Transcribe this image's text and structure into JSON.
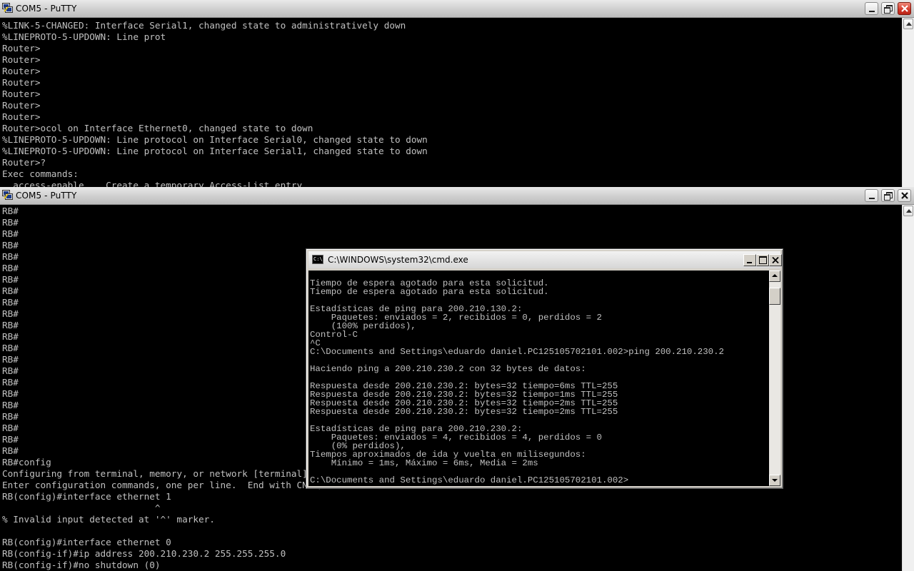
{
  "putty_top": {
    "title": "COM5 - PuTTY",
    "terminal_text": "%LINK-5-CHANGED: Interface Serial1, changed state to administratively down\n%LINEPROTO-5-UPDOWN: Line prot\nRouter>\nRouter>\nRouter>\nRouter>\nRouter>\nRouter>\nRouter>\nRouter>ocol on Interface Ethernet0, changed state to down\n%LINEPROTO-5-UPDOWN: Line protocol on Interface Serial0, changed state to down\n%LINEPROTO-5-UPDOWN: Line protocol on Interface Serial1, changed state to down\nRouter>?\nExec commands:\n  access-enable    Create a temporary Access-List entry"
  },
  "putty_bottom": {
    "title": "COM5 - PuTTY",
    "terminal_text": "RB#\nRB#\nRB#\nRB#\nRB#\nRB#\nRB#\nRB#\nRB#\nRB#\nRB#\nRB#\nRB#\nRB#\nRB#\nRB#\nRB#\nRB#\nRB#\nRB#\nRB#\nRB#\nRB#config\nConfiguring from terminal, memory, or network [terminal]?\nEnter configuration commands, one per line.  End with CNTL/Z.\nRB(config)#interface ethernet 1\n                            ^\n% Invalid input detected at '^' marker.\n\nRB(config)#interface ethernet 0\nRB(config-if)#ip address 200.210.230.2 255.255.255.0\nRB(config-if)#no shutdown (0)"
  },
  "cmd_window": {
    "title": "C:\\WINDOWS\\system32\\cmd.exe",
    "icon_text": "C:\\",
    "terminal_text": "Tiempo de espera agotado para esta solicitud.\nTiempo de espera agotado para esta solicitud.\n\nEstadísticas de ping para 200.210.130.2:\n    Paquetes: enviados = 2, recibidos = 0, perdidos = 2\n    (100% perdidos),\nControl-C\n^C\nC:\\Documents and Settings\\eduardo daniel.PC125105702101.002>ping 200.210.230.2\n\nHaciendo ping a 200.210.230.2 con 32 bytes de datos:\n\nRespuesta desde 200.210.230.2: bytes=32 tiempo=6ms TTL=255\nRespuesta desde 200.210.230.2: bytes=32 tiempo=1ms TTL=255\nRespuesta desde 200.210.230.2: bytes=32 tiempo=2ms TTL=255\nRespuesta desde 200.210.230.2: bytes=32 tiempo=2ms TTL=255\n\nEstadísticas de ping para 200.210.230.2:\n    Paquetes: enviados = 4, recibidos = 4, perdidos = 0\n    (0% perdidos),\nTiempos aproximados de ida y vuelta en milisegundos:\n    Mínimo = 1ms, Máximo = 6ms, Media = 2ms\n\nC:\\Documents and Settings\\eduardo daniel.PC125105702101.002>"
  },
  "colors": {
    "terminal_bg": "#000000",
    "terminal_fg": "#c0c0c0",
    "close_button_active": "#d2382a"
  },
  "icons": {
    "putty": "putty-icon",
    "minimize": "minimize-icon",
    "maximize": "maximize-icon",
    "close": "close-icon",
    "cmd": "cmd-icon"
  }
}
